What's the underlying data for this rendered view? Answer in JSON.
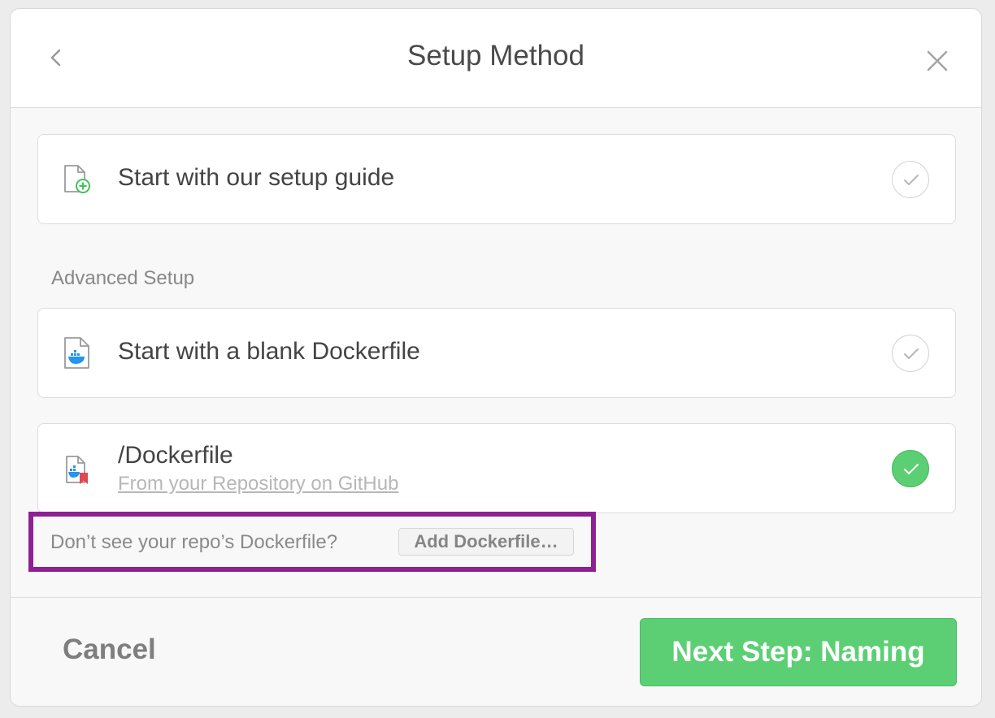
{
  "dialog": {
    "title": "Setup Method"
  },
  "options": {
    "setup_guide": {
      "label": "Start with our setup guide",
      "icon": "file-add-icon",
      "selected": false
    },
    "advanced_section_label": "Advanced Setup",
    "blank_dockerfile": {
      "label": "Start with a blank Dockerfile",
      "icon": "docker-file-icon",
      "selected": false
    },
    "repo_dockerfile": {
      "label": "/Dockerfile",
      "sublabel": "From your Repository on GitHub",
      "icon": "docker-file-bookmark-icon",
      "selected": true
    }
  },
  "hint": {
    "text": "Don’t see your repo’s Dockerfile?",
    "button_label": "Add Dockerfile…"
  },
  "footer": {
    "cancel_label": "Cancel",
    "next_label": "Next Step: Naming"
  },
  "colors": {
    "accent_green": "#5ccf74",
    "highlight_purple": "#8d2193",
    "docker_blue": "#2496ed",
    "bookmark_red": "#e0474f"
  }
}
